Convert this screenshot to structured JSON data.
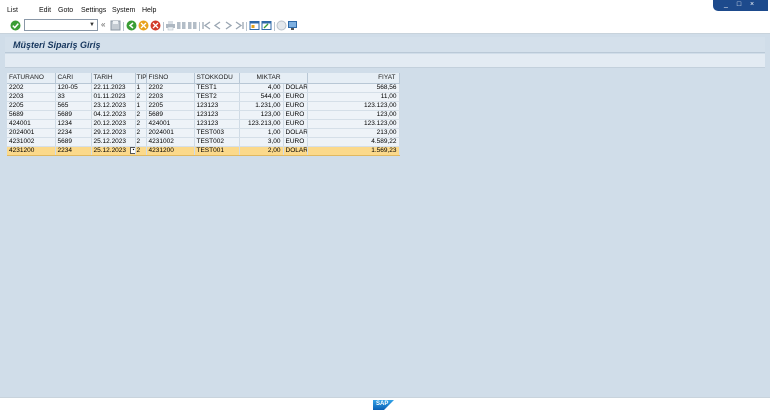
{
  "window": {
    "controls": [
      "_",
      "□",
      "×"
    ]
  },
  "menu": [
    {
      "label": "List"
    },
    {
      "label": "Edit"
    },
    {
      "label": "Goto"
    },
    {
      "label": "Settings"
    },
    {
      "label": "System"
    },
    {
      "label": "Help"
    }
  ],
  "toolbar": {
    "command_field_value": "",
    "icons": [
      "enter-icon",
      "save-icon",
      "back-icon",
      "exit-icon",
      "cancel-icon",
      "print-icon",
      "find-icon",
      "find-next-icon",
      "first-page-icon",
      "previous-page-icon",
      "next-page-icon",
      "last-page-icon",
      "create-session-icon",
      "shortcut-icon",
      "help-icon",
      "customize-layout-icon"
    ]
  },
  "page": {
    "title": "Müşteri Sipariş Giriş"
  },
  "table": {
    "columns": [
      "FATURANO",
      "CARI",
      "TARIH",
      "TIP",
      "FISNO",
      "STOKKODU",
      "MIKTAR",
      "",
      "FIYAT"
    ],
    "rows": [
      {
        "faturano": "2202",
        "cari": "120-05",
        "tarih": "22.11.2023",
        "tip": "1",
        "fisno": "2202",
        "stokkodu": "TEST1",
        "miktar": "4,00",
        "birim": "DOLAR",
        "fiyat": "568,56"
      },
      {
        "faturano": "2203",
        "cari": "33",
        "tarih": "01.11.2023",
        "tip": "2",
        "fisno": "2203",
        "stokkodu": "TEST2",
        "miktar": "544,00",
        "birim": "EURO",
        "fiyat": "11,00"
      },
      {
        "faturano": "2205",
        "cari": "565",
        "tarih": "23.12.2023",
        "tip": "1",
        "fisno": "2205",
        "stokkodu": "123123",
        "miktar": "1.231,00",
        "birim": "EURO",
        "fiyat": "123.123,00"
      },
      {
        "faturano": "5689",
        "cari": "5689",
        "tarih": "04.12.2023",
        "tip": "2",
        "fisno": "5689",
        "stokkodu": "123123",
        "miktar": "123,00",
        "birim": "EURO",
        "fiyat": "123,00"
      },
      {
        "faturano": "424001",
        "cari": "1234",
        "tarih": "20.12.2023",
        "tip": "2",
        "fisno": "424001",
        "stokkodu": "123123",
        "miktar": "123.213,00",
        "birim": "EURO",
        "fiyat": "123.123,00"
      },
      {
        "faturano": "2024001",
        "cari": "2234",
        "tarih": "29.12.2023",
        "tip": "2",
        "fisno": "2024001",
        "stokkodu": "TEST003",
        "miktar": "1,00",
        "birim": "DOLAR",
        "fiyat": "213,00"
      },
      {
        "faturano": "4231002",
        "cari": "5689",
        "tarih": "25.12.2023",
        "tip": "2",
        "fisno": "4231002",
        "stokkodu": "TEST002",
        "miktar": "3,00",
        "birim": "EURO",
        "fiyat": "4.589,22"
      },
      {
        "faturano": "4231200",
        "cari": "2234",
        "tarih": "25.12.2023",
        "tip": "2",
        "fisno": "4231200",
        "stokkodu": "TEST001",
        "miktar": "2,00",
        "birim": "DOLAR",
        "fiyat": "1.569,23"
      }
    ],
    "selected_row": 7
  },
  "status": {
    "logo_text": "SAP"
  },
  "colors": {
    "background": "#d0dde9",
    "selected_row": "#fbd98b",
    "title": "#16365d",
    "window_controls": "#1d4a8c"
  }
}
